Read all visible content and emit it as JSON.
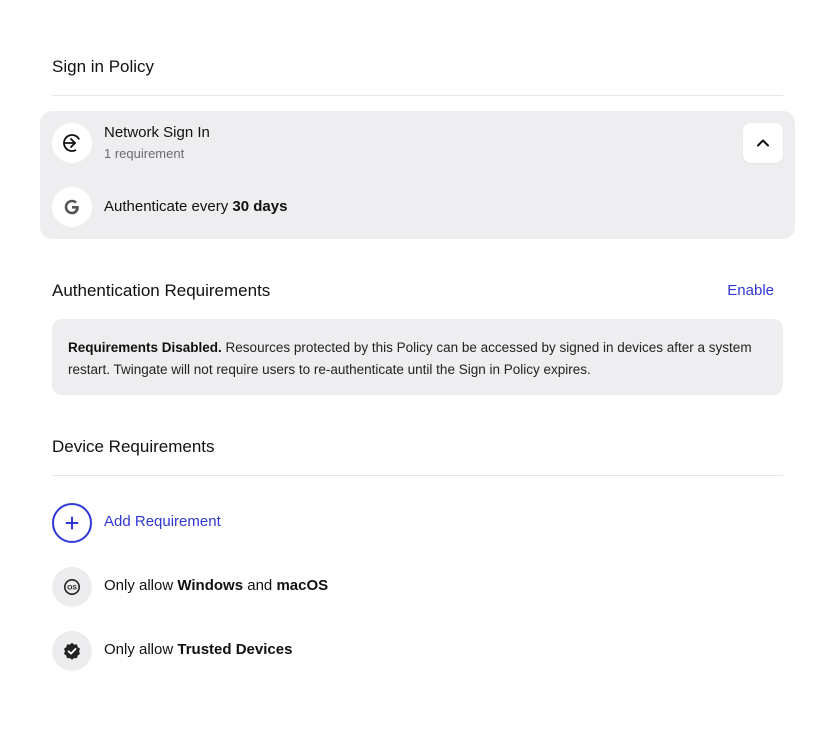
{
  "sign_in_policy": {
    "title": "Sign in Policy",
    "network": {
      "title": "Network Sign In",
      "subtitle": "1 requirement",
      "icon": "sign-in-arrow-icon",
      "collapse_icon": "chevron-up-icon"
    },
    "auth_row": {
      "icon": "google-icon",
      "prefix": "Authenticate every",
      "value": "30 days"
    }
  },
  "auth_requirements": {
    "title": "Authentication Requirements",
    "enable_label": "Enable",
    "notice_bold": "Requirements Disabled.",
    "notice_text": " Resources protected by this Policy can be accessed by signed in devices after a system restart. Twingate will not require users to re-authenticate until the Sign in Policy expires."
  },
  "device_requirements": {
    "title": "Device Requirements",
    "add_label": "Add Requirement",
    "add_icon": "plus-icon",
    "items": [
      {
        "icon": "os-icon",
        "prefix": "Only allow ",
        "bold1": "Windows",
        "middle": " and ",
        "bold2": "macOS"
      },
      {
        "icon": "verified-badge-icon",
        "prefix": "Only allow ",
        "bold1": "Trusted Devices"
      }
    ]
  },
  "colors": {
    "accent": "#2f37d6",
    "card_bg": "#eeeef0",
    "text": "#111111"
  }
}
